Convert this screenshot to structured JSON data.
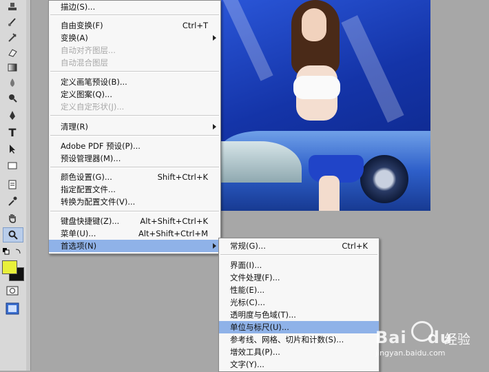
{
  "menu": {
    "items": [
      {
        "label": "描边(S)...",
        "shortcut": "",
        "disabled": false
      },
      {
        "label": "自由变换(F)",
        "shortcut": "Ctrl+T",
        "disabled": false
      },
      {
        "label": "变换(A)",
        "shortcut": "",
        "disabled": false,
        "submenu": true
      },
      {
        "label": "自动对齐图层...",
        "shortcut": "",
        "disabled": true
      },
      {
        "label": "自动混合图层",
        "shortcut": "",
        "disabled": true
      },
      {
        "label": "定义画笔预设(B)...",
        "shortcut": "",
        "disabled": false
      },
      {
        "label": "定义图案(Q)...",
        "shortcut": "",
        "disabled": false
      },
      {
        "label": "定义自定形状(J)...",
        "shortcut": "",
        "disabled": true
      },
      {
        "label": "清理(R)",
        "shortcut": "",
        "disabled": false,
        "submenu": true
      },
      {
        "label": "Adobe PDF 预设(P)...",
        "shortcut": "",
        "disabled": false
      },
      {
        "label": "预设管理器(M)...",
        "shortcut": "",
        "disabled": false
      },
      {
        "label": "颜色设置(G)...",
        "shortcut": "Shift+Ctrl+K",
        "disabled": false
      },
      {
        "label": "指定配置文件...",
        "shortcut": "",
        "disabled": false
      },
      {
        "label": "转换为配置文件(V)...",
        "shortcut": "",
        "disabled": false
      },
      {
        "label": "键盘快捷键(Z)...",
        "shortcut": "Alt+Shift+Ctrl+K",
        "disabled": false
      },
      {
        "label": "菜单(U)...",
        "shortcut": "Alt+Shift+Ctrl+M",
        "disabled": false
      },
      {
        "label": "首选项(N)",
        "shortcut": "",
        "disabled": false,
        "submenu": true,
        "highlighted": true
      }
    ]
  },
  "submenu": {
    "items": [
      {
        "label": "常规(G)...",
        "shortcut": "Ctrl+K"
      },
      {
        "label": "界面(I)...",
        "shortcut": ""
      },
      {
        "label": "文件处理(F)...",
        "shortcut": ""
      },
      {
        "label": "性能(E)...",
        "shortcut": ""
      },
      {
        "label": "光标(C)...",
        "shortcut": ""
      },
      {
        "label": "透明度与色域(T)...",
        "shortcut": ""
      },
      {
        "label": "单位与标尺(U)...",
        "shortcut": "",
        "highlighted": true
      },
      {
        "label": "参考线、网格、切片和计数(S)...",
        "shortcut": ""
      },
      {
        "label": "增效工具(P)...",
        "shortcut": ""
      },
      {
        "label": "文字(Y)...",
        "shortcut": ""
      }
    ]
  },
  "toolbar": {
    "tools": [
      "stamp-icon",
      "history-brush-icon",
      "eraser-icon",
      "gradient-icon",
      "blur-icon",
      "dodge-icon",
      "pen-icon",
      "type-icon",
      "path-select-icon",
      "shape-icon",
      "notes-icon",
      "eyedropper-icon",
      "hand-icon",
      "zoom-icon"
    ],
    "type_glyph": "T",
    "foreground_color": "#e8f03a",
    "background_color": "#111111"
  },
  "watermark": {
    "brand": "Bai",
    "brand2": "du",
    "cn": "经验",
    "url": "jingyan.baidu.com"
  }
}
